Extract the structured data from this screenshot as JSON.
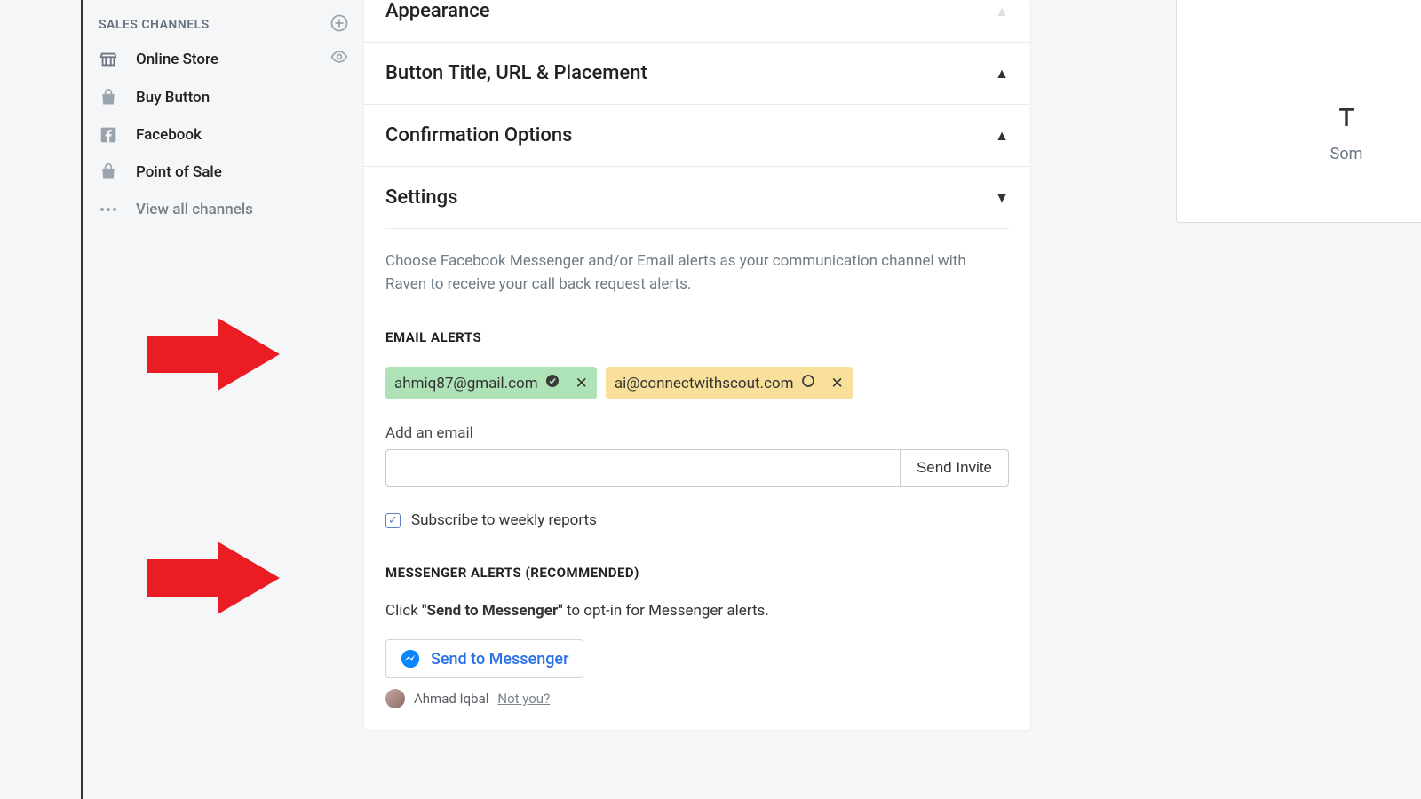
{
  "sidebar": {
    "header": "SALES CHANNELS",
    "items": [
      {
        "label": "Online Store"
      },
      {
        "label": "Buy Button"
      },
      {
        "label": "Facebook"
      },
      {
        "label": "Point of Sale"
      },
      {
        "label": "View all channels"
      }
    ]
  },
  "accordion": {
    "appearance": "Appearance",
    "button": "Button Title, URL & Placement",
    "confirmation": "Confirmation Options",
    "settings": "Settings"
  },
  "settings": {
    "description": "Choose Facebook Messenger and/or Email alerts as your communication channel with Raven to receive your call back request alerts.",
    "email_section_label": "EMAIL ALERTS",
    "emails": [
      {
        "address": "ahmiq87@gmail.com",
        "verified": true
      },
      {
        "address": "ai@connectwithscout.com",
        "verified": false
      }
    ],
    "add_email_label": "Add an email",
    "send_invite": "Send Invite",
    "subscribe_label": "Subscribe to weekly reports",
    "subscribe_checked": true,
    "messenger_section_label": "MESSENGER ALERTS (RECOMMENDED)",
    "messenger_hint_pre": "Click ",
    "messenger_hint_bold": "\"Send to Messenger\"",
    "messenger_hint_post": " to opt-in for Messenger alerts.",
    "messenger_button": "Send to Messenger",
    "user_name": "Ahmad Iqbal",
    "not_you": "Not you?"
  },
  "right_card": {
    "line1": "T",
    "line2": "Som"
  }
}
